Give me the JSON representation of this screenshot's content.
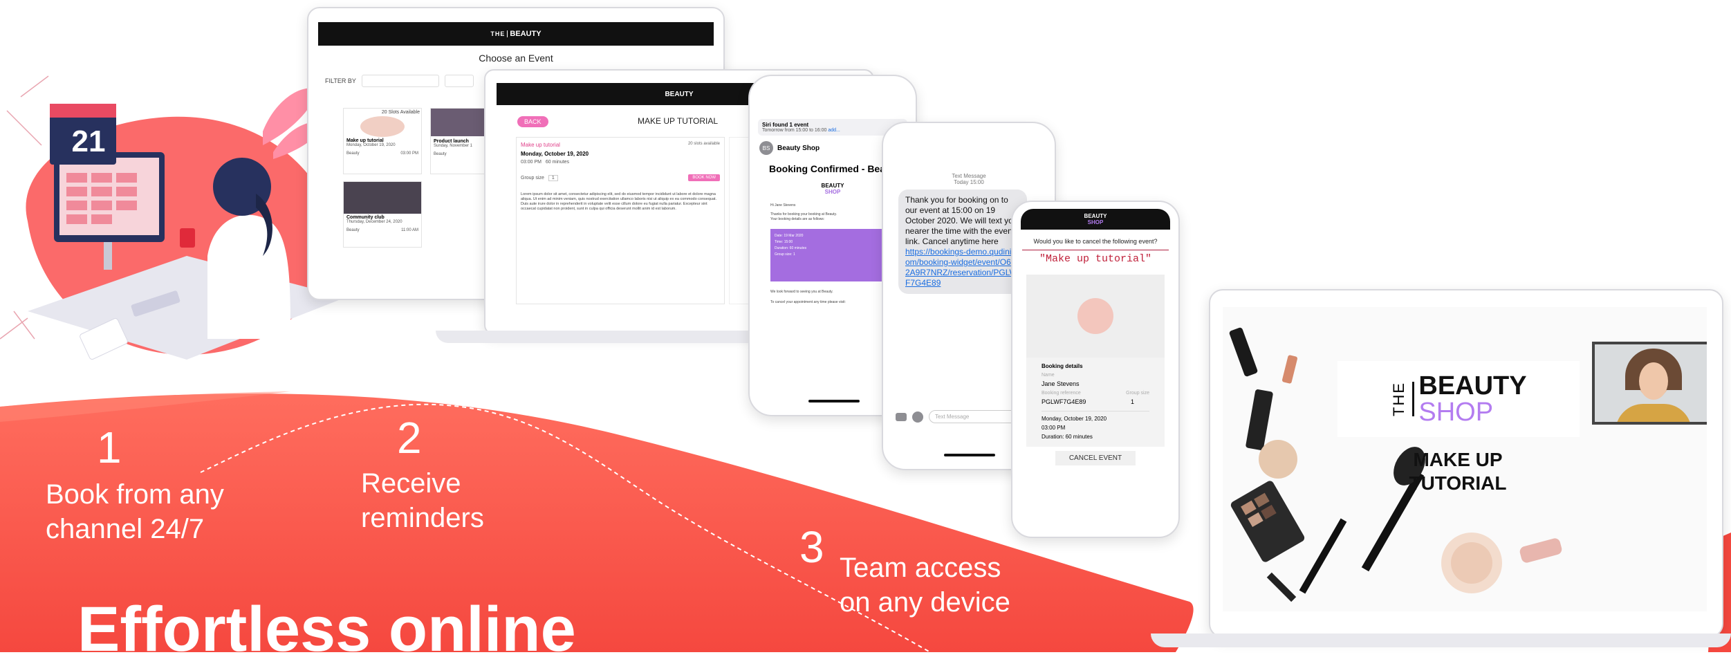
{
  "steps": [
    {
      "number": "1",
      "text_line1": "Book from any",
      "text_line2": "channel 24/7"
    },
    {
      "number": "2",
      "text_line1": "Receive",
      "text_line2": "reminders"
    },
    {
      "number": "3",
      "text_line1": "Team access",
      "text_line2": "on any device"
    }
  ],
  "headline": "Effortless online",
  "calendar_day": "21",
  "laptop1": {
    "logo_the": "THE",
    "logo_beauty": "BEAUTY",
    "title": "Choose an Event",
    "filter_label": "FILTER BY",
    "cards": [
      {
        "badge": "20 Slots Available",
        "name": "Make up tutorial",
        "date": "Monday, October 19, 2020",
        "tag": "Beauty",
        "time": "03:00 PM"
      },
      {
        "badge": "",
        "name": "Product launch",
        "date": "Sunday, November 1",
        "tag": "Beauty",
        "time": ""
      },
      {
        "badge": "",
        "name": "Community club",
        "date": "Thursday, December 24, 2020",
        "tag": "Beauty",
        "time": "11:00 AM"
      }
    ]
  },
  "laptop2": {
    "logo_beauty": "BEAUTY",
    "back": "BACK",
    "title": "MAKE UP TUTORIAL",
    "event_name": "Make up tutorial",
    "event_date": "Monday, October 19, 2020",
    "event_time": "03:00 PM",
    "duration": "60 minutes",
    "slots": "20 slots available",
    "group_size_label": "Group size",
    "group_size_value": "1",
    "book_button": "BOOK NOW",
    "description": "Lorem ipsum dolor sit amet, consectetur adipiscing elit, sed do eiusmod tempor incididunt ut labore et dolore magna aliqua. Ut enim ad minim veniam, quis nostrud exercitation ullamco laboris nisi ut aliquip ex ea commodo consequat. Duis aute irure dolor in reprehenderit in voluptate velit esse cillum dolore eu fugiat nulla pariatur. Excepteur sint occaecat cupidatat non proident, sunt in culpa qui officia deserunt mollit anim id est laborum."
  },
  "phone1": {
    "siri_title": "Siri found 1 event",
    "siri_sub": "Tomorrow from 15:00 to 16:00",
    "siri_add": "add...",
    "sender_initials": "BS",
    "sender": "Beauty Shop",
    "subject": "Booking Confirmed - Beauty",
    "logo_beauty": "BEAUTY",
    "logo_shop": "SHOP",
    "greeting": "Hi Jane Stevens",
    "thanks": "Thanks for booking your booking at Beauty.",
    "details_line": "Your booking details are as follows:",
    "purple_lines": [
      "Date: 19 Mar 2020",
      "Time: 15:00",
      "Duration: 60 minutes",
      "Group size: 1"
    ],
    "footer1": "We look forward to seeing you at Beauty.",
    "footer2": "To cancel your appointment any time please visit:"
  },
  "phone2": {
    "meta1": "Text Message",
    "meta2": "Today 15:00",
    "message": "Thank you for booking on to our event at 15:00 on 19 October 2020. We will text you nearer the time with the event link. Cancel anytime here",
    "link": "https://bookings-demo.qudini.com/booking-widget/event/O6M2A9R7NRZ/reservation/PGLWF7G4E89",
    "input_placeholder": "Text Message"
  },
  "phone3": {
    "logo_beauty": "BEAUTY",
    "logo_shop": "SHOP",
    "question": "Would you like to cancel the following event?",
    "event": "\"Make up tutorial\"",
    "details_heading": "Booking details",
    "name_label": "Name",
    "name": "Jane Stevens",
    "ref_label": "Booking reference",
    "group_label": "Group size",
    "ref": "PGLWF7G4E89",
    "group": "1",
    "date": "Monday, October 19, 2020",
    "time": "03:00 PM",
    "duration": "Duration: 60 minutes",
    "cancel_button": "CANCEL EVENT"
  },
  "laptop3": {
    "logo_the": "THE",
    "logo_beauty": "BEAUTY",
    "logo_shop": "SHOP",
    "title_line1": "MAKE UP",
    "title_line2": "TUTORIAL"
  },
  "colors": {
    "coral": "#fb5d52",
    "coral_light": "#ff7a6b",
    "pink": "#f06fb8",
    "purple": "#a46de0"
  }
}
